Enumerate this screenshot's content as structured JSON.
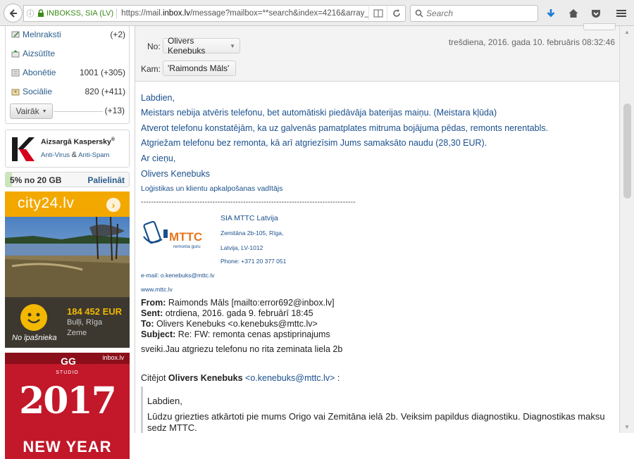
{
  "browser": {
    "identity": "INBOKSS, SIA (LV)",
    "url_prefix": "https://mail.",
    "url_domain": "inbox.lv",
    "url_suffix": "/message?mailbox=**search&index=4216&array_index",
    "search_placeholder": "Search"
  },
  "folders": [
    {
      "name": "Melnraksti",
      "count": "(+2)",
      "icon": "draft-icon"
    },
    {
      "name": "Aizsūtīte",
      "count": "",
      "icon": "sent-icon"
    },
    {
      "name": "Abonētie",
      "count": "1001 (+305)",
      "icon": "subscription-icon"
    },
    {
      "name": "Sociālie",
      "count": "820 (+411)",
      "icon": "social-icon"
    }
  ],
  "more": {
    "label": "Vairāk",
    "count": "(+13)"
  },
  "kaspersky": {
    "title": "Aizsargā Kaspersky",
    "reg": "®",
    "link1": "Anti-Virus",
    "amp": "&",
    "link2": "Anti-Spam"
  },
  "quota": {
    "text": "5% no 20 GB",
    "link": "Palielināt",
    "percent": 5
  },
  "ad_city24": {
    "logo": "city24.lv",
    "arrow": "›",
    "price": "184 452 EUR",
    "location": "Bulļi, Rīga",
    "type": "Zeme",
    "owner": "No īpašnieka"
  },
  "ad_studio": {
    "brand": "inbox.lv",
    "logo": "GG",
    "studio": "STUDIO",
    "year": "2017",
    "tagline": "NEW YEAR"
  },
  "message": {
    "from_label": "No:",
    "from": "Olivers Kenebuks",
    "to_label": "Kam:",
    "to": "'Raimonds Māls'",
    "date": "trešdiena, 2016. gada 10. februāris 08:32:46",
    "body": {
      "greeting": "Labdien,",
      "p1": "Meistars nebija atvēris telefonu, bet automātiski piedāvāja baterijas maiņu. (Meistara kļūda)",
      "p2": "Atverot telefonu konstatējām, ka uz galvenās pamatplates mitruma bojājuma pēdas, remonts nerentabls.",
      "p3": "Atgriežam telefonu bez remonta, kā arī atgriezīsim Jums samaksāto naudu (28,30 EUR).",
      "closing": "Ar cieņu,",
      "name": "Olivers Kenebuks",
      "role": "Loģistikas un klientu apkalpošanas vadītājs",
      "separator": "------------------------------------------------------------------------------------"
    },
    "signature": {
      "company": "SIA MTTC Latvija",
      "addr1": "Zemitāna 2b-105, Rīga,",
      "addr2": "Latvija, LV-1012",
      "phone": "Phone: +371 20 377 051",
      "email": "e-mail: o.kenebuks@mttc.lv",
      "web": "www.mttc.lv",
      "logo_text": "MTTC",
      "logo_sub": "remonta guru"
    },
    "forwarded": {
      "from_label": "From:",
      "from": "Raimonds Māls [mailto:error692@inbox.lv]",
      "sent_label": "Sent:",
      "sent": "otrdiena, 2016. gada 9. februārī 18:45",
      "to_label": "To:",
      "to": "Olivers Kenebuks <o.kenebuks@mttc.lv>",
      "subject_label": "Subject:",
      "subject": "Re: FW: remonta cenas apstiprinajums",
      "text": "sveiki.Jau atgriezu telefonu no rita zeminata liela 2b"
    },
    "citation": {
      "prefix": "Citējot",
      "name": "Olivers Kenebuks",
      "email": "<o.kenebuks@mttc.lv>",
      "suffix": ":"
    },
    "quoted": {
      "greeting": "Labdien,",
      "p1": "Lūdzu griezties atkārtoti pie mums Origo vai Zemitāna ielā 2b. Veiksim papildus diagnostiku. Diagnostikas maksu",
      "p2": "sedz MTTC."
    }
  },
  "colors": {
    "link": "#1a4f8c",
    "accent": "#f3a800",
    "brand_red": "#c2182a",
    "secure": "#3a8a19"
  }
}
